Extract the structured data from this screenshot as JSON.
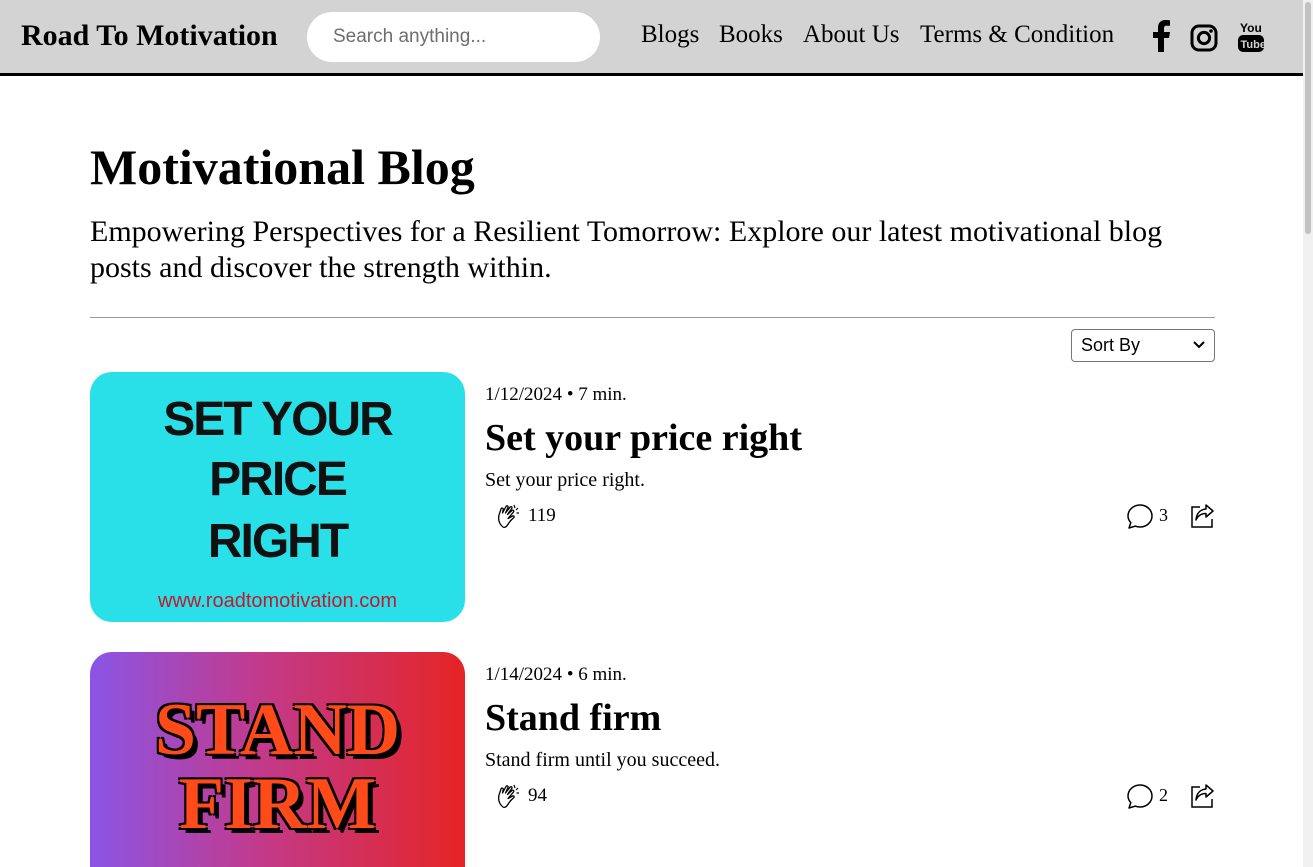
{
  "header": {
    "brand": "Road To Motivation",
    "search_placeholder": "Search anything...",
    "nav": [
      "Blogs",
      "Books",
      "About Us",
      "Terms & Condition"
    ],
    "social_icons": [
      "facebook-icon",
      "instagram-icon",
      "youtube-icon"
    ]
  },
  "main": {
    "title": "Motivational Blog",
    "subtitle": "Empowering Perspectives for a Resilient Tomorrow: Explore our latest motivational blog posts and discover the strength within.",
    "sort_label": "Sort By"
  },
  "posts": [
    {
      "image_lines": [
        "SET YOUR",
        "PRICE",
        "RIGHT"
      ],
      "image_url_text": "www.roadtomotivation.com",
      "image_color": "#2ae0e8",
      "date": "1/12/2024",
      "read_time": "7 min.",
      "title": "Set your price right",
      "excerpt": "Set your price right.",
      "likes": "119",
      "comments": "3"
    },
    {
      "image_lines": [
        "STAND",
        "FIRM"
      ],
      "date": "1/14/2024",
      "read_time": "6 min.",
      "title": "Stand firm",
      "excerpt": "Stand firm until you succeed.",
      "likes": "94",
      "comments": "2"
    }
  ]
}
